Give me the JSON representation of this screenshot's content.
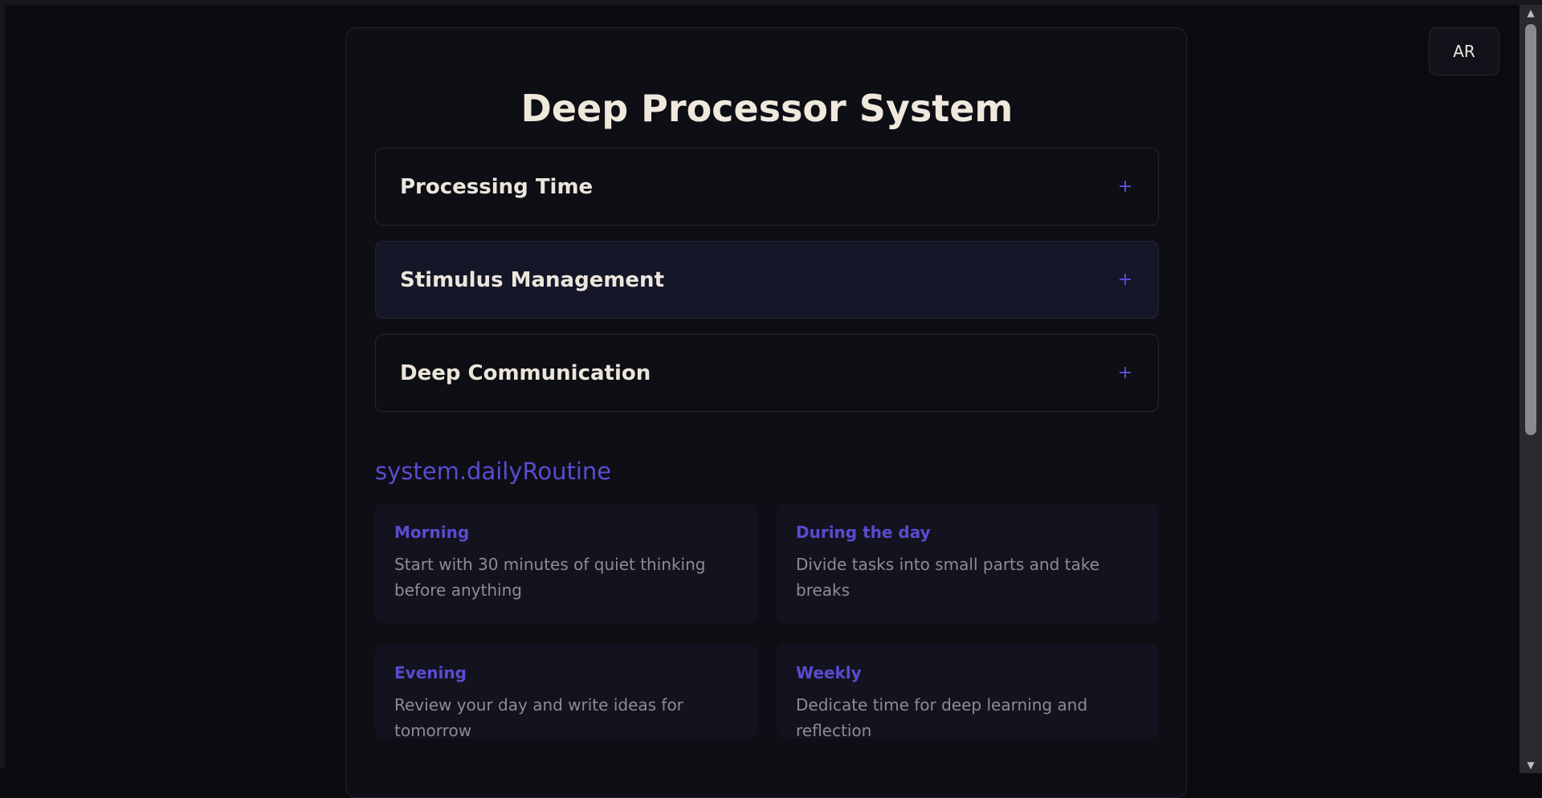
{
  "page": {
    "title": "Deep Processor System"
  },
  "language_button": {
    "label": "AR"
  },
  "accordions": [
    {
      "label": "Processing Time",
      "icon": "plus-icon"
    },
    {
      "label": "Stimulus Management",
      "icon": "plus-icon"
    },
    {
      "label": "Deep Communication",
      "icon": "plus-icon"
    }
  ],
  "daily_routine": {
    "heading": "system.dailyRoutine",
    "items": [
      {
        "title": "Morning",
        "text": "Start with 30 minutes of quiet thinking before anything"
      },
      {
        "title": "During the day",
        "text": "Divide tasks into small parts and take breaks"
      },
      {
        "title": "Evening",
        "text": "Review your day and write ideas for tomorrow"
      },
      {
        "title": "Weekly",
        "text": "Dedicate time for deep learning and reflection"
      }
    ]
  },
  "colors": {
    "background": "#0b0b10",
    "card": "#0e0e15",
    "accent": "#5b4bd0",
    "heading_text": "#efe9dd",
    "body_text": "#8c8b98"
  }
}
